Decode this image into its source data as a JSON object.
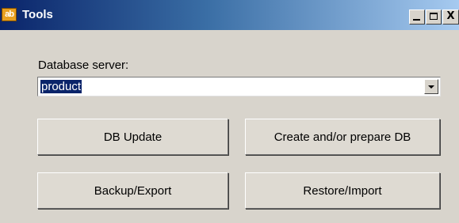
{
  "window": {
    "icon_text": "ab",
    "title": "Tools",
    "controls": {
      "close_label": "X"
    }
  },
  "form": {
    "server_label": "Database server:",
    "server_value": "product"
  },
  "buttons": {
    "db_update": "DB Update",
    "create_prepare": "Create and/or prepare DB",
    "backup_export": "Backup/Export",
    "restore_import": "Restore/Import"
  },
  "icons": [
    "app-icon",
    "minimize-icon",
    "maximize-icon",
    "close-icon",
    "chevron-down-icon"
  ]
}
